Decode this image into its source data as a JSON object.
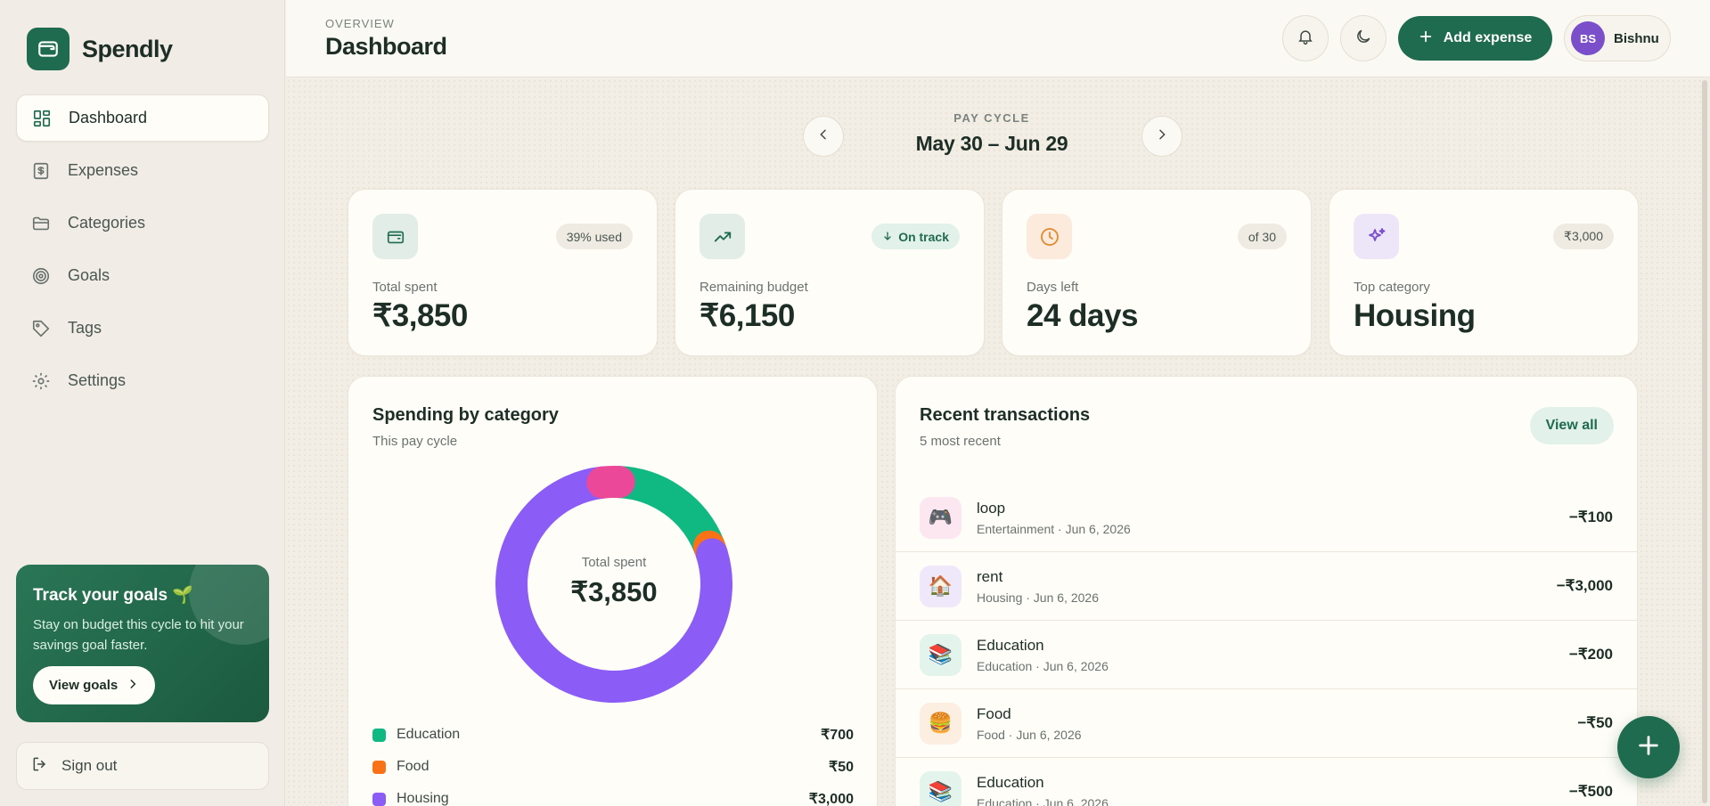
{
  "brand": {
    "name": "Spendly"
  },
  "sidebar": {
    "items": [
      {
        "label": "Dashboard",
        "icon": "dashboard-grid-icon",
        "active": true
      },
      {
        "label": "Expenses",
        "icon": "dollar-receipt-icon"
      },
      {
        "label": "Categories",
        "icon": "folder-icon"
      },
      {
        "label": "Goals",
        "icon": "target-icon"
      },
      {
        "label": "Tags",
        "icon": "tag-icon"
      },
      {
        "label": "Settings",
        "icon": "gear-icon"
      }
    ],
    "promo": {
      "title": "Track your goals 🌱",
      "text": "Stay on budget this cycle to hit your savings goal faster.",
      "button": "View goals"
    },
    "signout": "Sign out"
  },
  "header": {
    "overline": "OVERVIEW",
    "title": "Dashboard",
    "add_button": "Add expense",
    "user": {
      "initials": "BS",
      "name": "Bishnu"
    }
  },
  "cycle": {
    "label": "PAY CYCLE",
    "range": "May 30 – Jun 29"
  },
  "stats": [
    {
      "label": "Total spent",
      "value": "₹3,850",
      "badge": "39% used",
      "icon": "wallet-icon"
    },
    {
      "label": "Remaining budget",
      "value": "₹6,150",
      "badge": "On track",
      "icon": "trending-up-icon"
    },
    {
      "label": "Days left",
      "value": "24 days",
      "badge": "of 30",
      "icon": "clock-icon"
    },
    {
      "label": "Top category",
      "value": "Housing",
      "badge": "₹3,000",
      "icon": "sparkles-icon"
    }
  ],
  "spending": {
    "title": "Spending by category",
    "subtitle": "This pay cycle",
    "center_label": "Total spent",
    "center_value": "₹3,850",
    "legend": [
      {
        "name": "Education",
        "value": "₹700",
        "color": "#10b981"
      },
      {
        "name": "Food",
        "value": "₹50",
        "color": "#f97316"
      },
      {
        "name": "Housing",
        "value": "₹3,000",
        "color": "#8b5cf6"
      }
    ],
    "segments": [
      {
        "name": "Education",
        "amount": 700,
        "color": "#10b981"
      },
      {
        "name": "Food",
        "amount": 50,
        "color": "#f97316"
      },
      {
        "name": "Housing",
        "amount": 3000,
        "color": "#8b5cf6"
      },
      {
        "name": "Entertainment",
        "amount": 100,
        "color": "#ec4899"
      }
    ]
  },
  "transactions": {
    "title": "Recent transactions",
    "subtitle": "5 most recent",
    "view_all": "View all",
    "items": [
      {
        "title": "loop",
        "meta": "Entertainment · Jun 6, 2026",
        "amount": "−₹100",
        "emoji": "🎮",
        "bg": "#fce7f1"
      },
      {
        "title": "rent",
        "meta": "Housing · Jun 6, 2026",
        "amount": "−₹3,000",
        "emoji": "🏠",
        "bg": "#efe8fb"
      },
      {
        "title": "Education",
        "meta": "Education · Jun 6, 2026",
        "amount": "−₹200",
        "emoji": "📚",
        "bg": "#e2f4ec"
      },
      {
        "title": "Food",
        "meta": "Food · Jun 6, 2026",
        "amount": "−₹50",
        "emoji": "🍔",
        "bg": "#fdeee2"
      },
      {
        "title": "Education",
        "meta": "Education · Jun 6, 2026",
        "amount": "−₹500",
        "emoji": "📚",
        "bg": "#e2f4ec"
      }
    ]
  }
}
